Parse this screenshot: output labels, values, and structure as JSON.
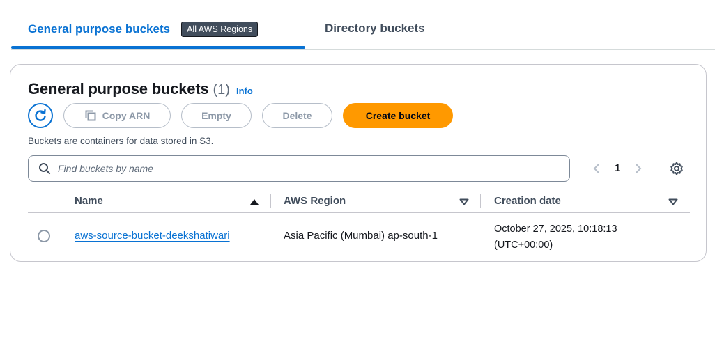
{
  "tabs": {
    "general_label": "General purpose buckets",
    "region_badge": "All AWS Regions",
    "directory_label": "Directory buckets"
  },
  "container": {
    "title": "General purpose buckets",
    "count": "(1)",
    "info_link": "Info",
    "description": "Buckets are containers for data stored in S3."
  },
  "actions": {
    "refresh_icon": "refresh-icon",
    "copy_arn": "Copy ARN",
    "empty": "Empty",
    "delete": "Delete",
    "create": "Create bucket"
  },
  "search": {
    "placeholder": "Find buckets by name",
    "value": ""
  },
  "pagination": {
    "current_page": "1"
  },
  "table": {
    "columns": [
      "Name",
      "AWS Region",
      "Creation date"
    ],
    "rows": [
      {
        "name": "aws-source-bucket-deekshatiwari",
        "region": "Asia Pacific (Mumbai) ap-south-1",
        "creation_date_line1": "October 27, 2025, 10:18:13",
        "creation_date_line2": "(UTC+00:00)"
      }
    ]
  },
  "colors": {
    "accent": "#0972d3",
    "primary_button": "#ff9900",
    "badge_bg": "#414d5c"
  }
}
